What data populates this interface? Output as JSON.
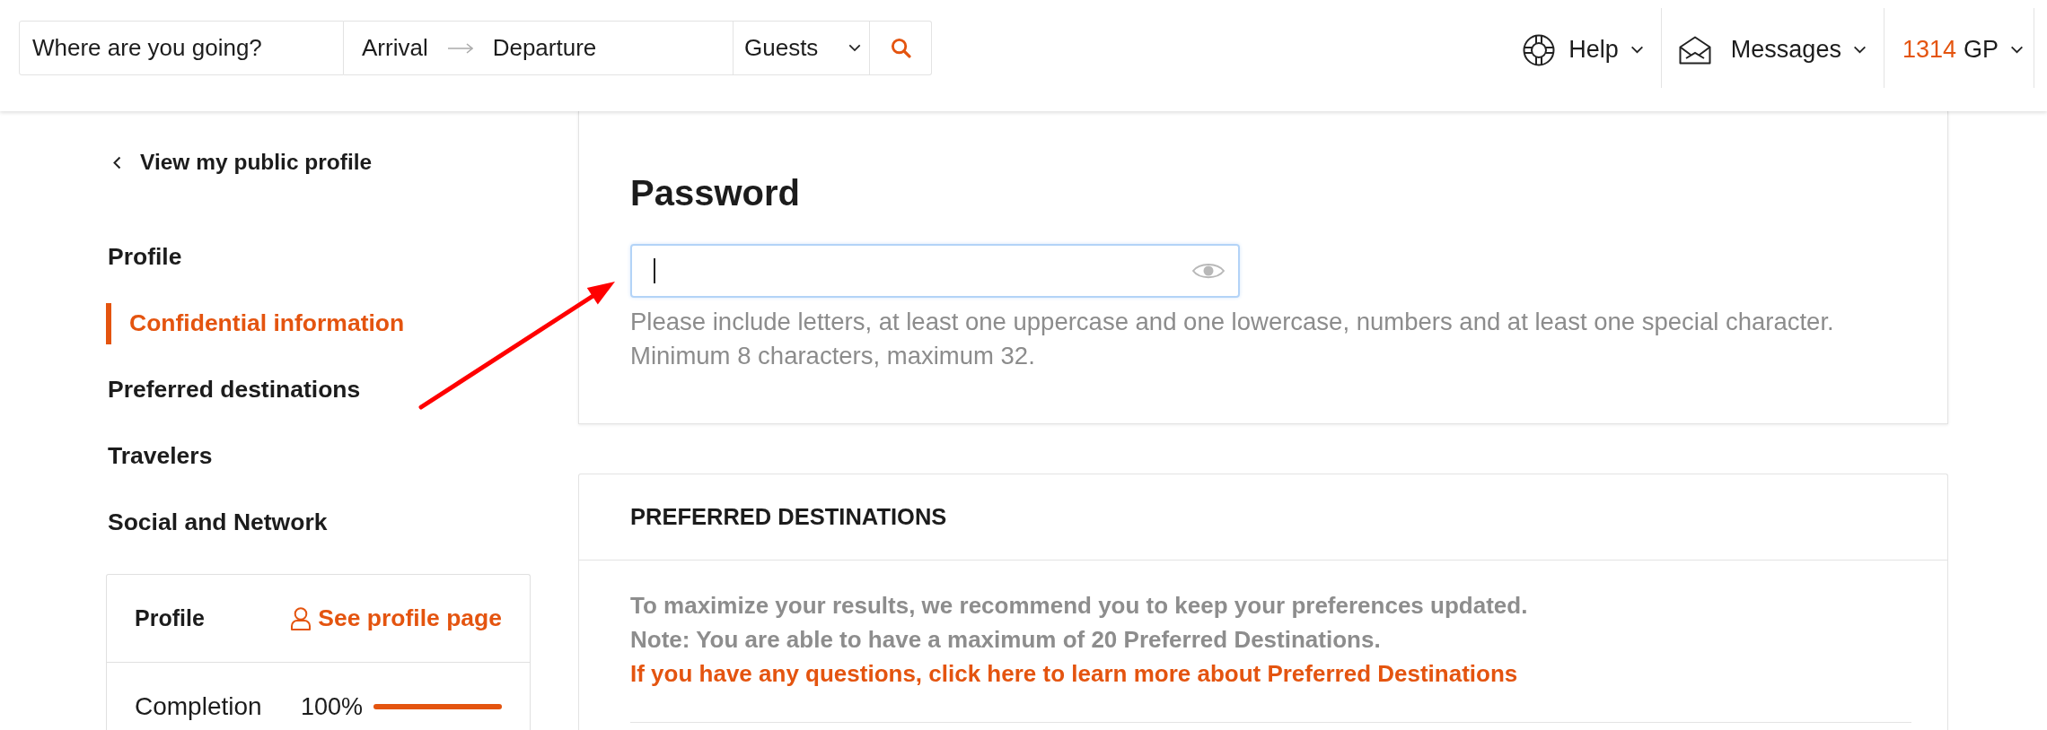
{
  "search_bar": {
    "destination": {
      "placeholder": "Where are you going?"
    },
    "dates": {
      "arrival": "Arrival",
      "departure": "Departure"
    },
    "guests": "Guests"
  },
  "header_menu": [
    {
      "kind": "help",
      "label": "Help"
    },
    {
      "kind": "messages",
      "label": "Messages"
    },
    {
      "kind": "points",
      "amount": "1314",
      "label": "GP"
    }
  ],
  "sidebar": {
    "back_link": "View my public profile",
    "items": [
      {
        "label": "Profile",
        "selected": false
      },
      {
        "label": "Confidential information",
        "selected": true
      },
      {
        "label": "Preferred destinations",
        "selected": false
      },
      {
        "label": "Travelers",
        "selected": false
      },
      {
        "label": "Social and Network",
        "selected": false
      }
    ],
    "profile_card": {
      "title": "Profile",
      "link": "See profile page",
      "completion": {
        "label": "Completion",
        "value": "100%",
        "level": 1
      }
    }
  },
  "password_section": {
    "title": "Password",
    "field": {
      "focused": true
    },
    "hint_lines": [
      "Please include letters, at least one uppercase and one lowercase, numbers and at least one special character.",
      "Minimum 8 characters, maximum 32."
    ]
  },
  "preferred_destinations": {
    "title": "PREFERRED DESTINATIONS",
    "notes": [
      "To maximize your results, we recommend you to keep your preferences updated.",
      "Note: You are able to have a maximum of 20 Preferred Destinations."
    ],
    "link": "If you have any questions, click here to learn more about Preferred Destinations"
  }
}
